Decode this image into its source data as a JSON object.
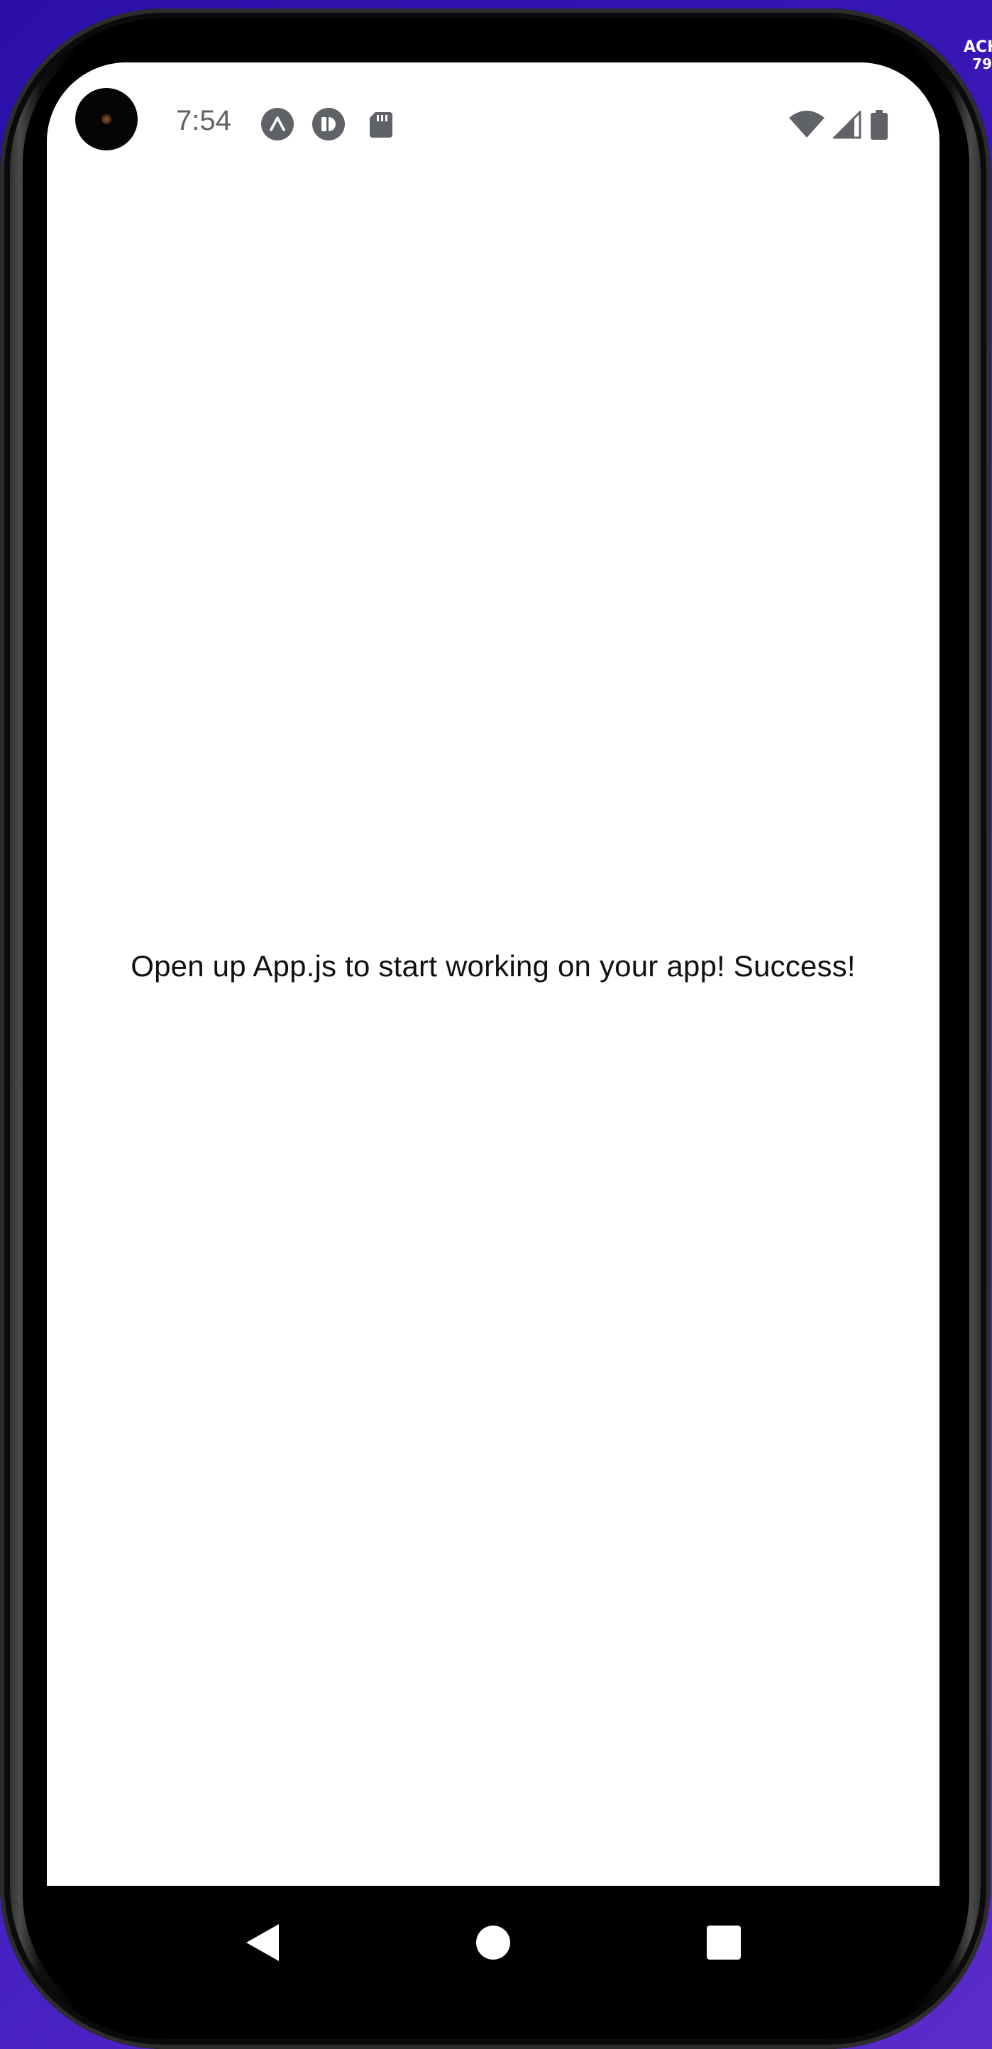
{
  "status_bar": {
    "time": "7:54",
    "notification_icons": [
      "expo-icon",
      "react-native-icon",
      "sd-card-icon"
    ],
    "system_icons": [
      "wifi-icon",
      "cell-signal-icon",
      "battery-icon"
    ]
  },
  "app": {
    "message": "Open up App.js to start working on your app! Success!"
  },
  "navigation": {
    "buttons": [
      "back",
      "home",
      "recents"
    ]
  },
  "desktop_edge": {
    "line1": "ACHO",
    "line2": "79"
  },
  "colors": {
    "background_gradient_start": "#2b0fa8",
    "background_gradient_end": "#5a2cc8",
    "screen_bg": "#ffffff",
    "status_icon": "#5f6368",
    "text": "#111111",
    "nav_bar": "#000000"
  }
}
